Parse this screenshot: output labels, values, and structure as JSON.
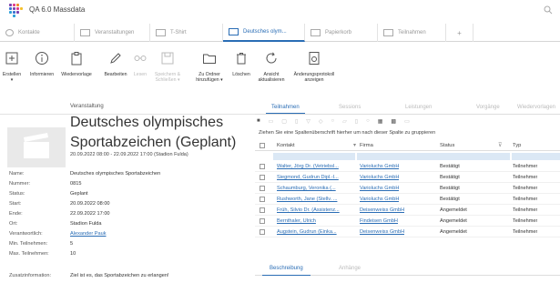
{
  "app": {
    "title": "QA 6.0 Massdata"
  },
  "tabs": [
    {
      "label": "Kontakte"
    },
    {
      "label": "Veranstaltungen"
    },
    {
      "label": "T-Shirt"
    },
    {
      "label": "Deutsches olym..."
    },
    {
      "label": "Papierkorb"
    },
    {
      "label": "Teilnahmen"
    },
    {
      "label": "+"
    }
  ],
  "ribbon": [
    {
      "label": "Erstellen",
      "sub": "▾"
    },
    {
      "label": "Informieren"
    },
    {
      "label": "Wiedervorlage"
    },
    {
      "label": "Bearbeiten"
    },
    {
      "label": "Lesen"
    },
    {
      "label": "Speichern &",
      "sub": "Schließen ▾"
    },
    {
      "label": "Zu Ordner",
      "sub": "hinzufügen ▾"
    },
    {
      "label": "Löschen"
    },
    {
      "label": "Ansicht",
      "sub": "aktualisieren"
    },
    {
      "label": "Änderungsprotokoll",
      "sub": "anzeigen"
    }
  ],
  "event": {
    "type": "Veranstaltung",
    "title": "Deutsches olympisches Sportabzeichen (Geplant)",
    "dates": "20.09.2022 08:00 - 22.09.2022 17:00 (Stadion Fulda)"
  },
  "details": [
    {
      "label": "Name:",
      "value": "Deutsches olympisches Sportabzeichen"
    },
    {
      "label": "Nummer:",
      "value": "0815"
    },
    {
      "label": "Status:",
      "value": "Geplant"
    },
    {
      "label": "Start:",
      "value": "20.09.2022 08:00"
    },
    {
      "label": "Ende:",
      "value": "22.09.2022 17:00"
    },
    {
      "label": "Ort:",
      "value": "Stadion Fulda"
    },
    {
      "label": "Verantwortlich:",
      "value": "Alexander Pauk"
    },
    {
      "label": "Min. Teilnehmen:",
      "value": "5"
    },
    {
      "label": "Max. Teilnehmen:",
      "value": "10"
    },
    {
      "label": "Zusatzinformation:",
      "value": "Ziel ist es, das Sportabzeichen zu erlangen!"
    }
  ],
  "right_tabs": [
    "Teilnahmen",
    "Sessions",
    "Leistungen",
    "Vorgänge",
    "Wiedervorlagen"
  ],
  "group_hint": "Ziehen Sie eine Spaltenüberschrift hierher um nach dieser Spalte zu gruppieren",
  "grid": {
    "headers": [
      "Kontakt",
      "Firma",
      "Status",
      "Typ"
    ],
    "rows": [
      [
        "Walter, Jörg Dr. (Vetriebsl...",
        "Varioluchs GmbH",
        "Bestätigt",
        "Teilnehmer"
      ],
      [
        "Siegmond, Gudrun Dipl.-I...",
        "Varioluchs GmbH",
        "Bestätigt",
        "Teilnehmer"
      ],
      [
        "Schaumburg, Veronika (...",
        "Varioluchs GmbH",
        "Bestätigt",
        "Teilnehmer"
      ],
      [
        "Rushworth, Jane (Stellv. ...",
        "Varioluchs GmbH",
        "Bestätigt",
        "Teilnehmer"
      ],
      [
        "Früh, Silvio Dr. (Assistenz...",
        "Deisenweiss GmbH",
        "Angemeldet",
        "Teilnehmer"
      ],
      [
        "Bernthaler, Ulrich",
        "Findeisen GmbH",
        "Angemeldet",
        "Teilnehmer"
      ],
      [
        "Augstein, Gudrun (Einka...",
        "Deisenweiss GmbH",
        "Angemeldet",
        "Teilnehmer"
      ]
    ]
  },
  "bottom_tabs": [
    "Beschreibung",
    "Anhänge"
  ],
  "colors": {
    "accent": "#2a6db5"
  }
}
